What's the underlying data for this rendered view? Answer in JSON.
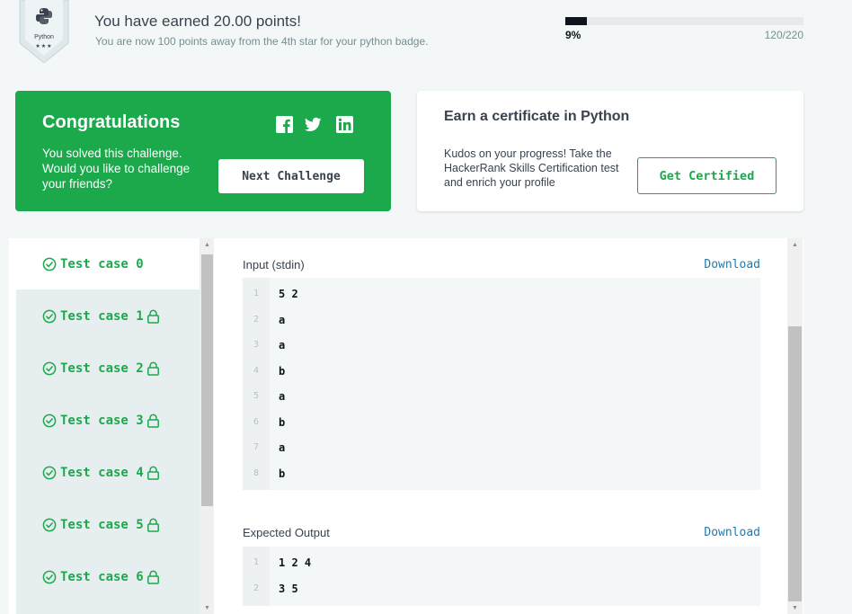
{
  "badge": {
    "label": "Python",
    "stars": "★★★",
    "icon": "python-logo-icon"
  },
  "earned": {
    "title": "You have earned 20.00 points!",
    "subtitle": "You are now 100 points away from the 4th star for your python badge."
  },
  "progress": {
    "percent_label": "9%",
    "count": "120/220",
    "fraction": 0.09
  },
  "congrats": {
    "title": "Congratulations",
    "message": "You solved this challenge. Would you like to challenge your friends?",
    "next_button": "Next Challenge",
    "social_icons": [
      "facebook-icon",
      "twitter-icon",
      "linkedin-icon"
    ]
  },
  "certificate": {
    "title": "Earn a certificate in Python",
    "text": "Kudos on your progress! Take the HackerRank Skills Certification test and enrich your profile",
    "button": "Get Certified"
  },
  "test_cases": [
    {
      "label": "Test case 0",
      "locked": false,
      "active": true
    },
    {
      "label": "Test case 1",
      "locked": true,
      "active": false
    },
    {
      "label": "Test case 2",
      "locked": true,
      "active": false
    },
    {
      "label": "Test case 3",
      "locked": true,
      "active": false
    },
    {
      "label": "Test case 4",
      "locked": true,
      "active": false
    },
    {
      "label": "Test case 5",
      "locked": true,
      "active": false
    },
    {
      "label": "Test case 6",
      "locked": true,
      "active": false
    }
  ],
  "input": {
    "label": "Input (stdin)",
    "download": "Download",
    "lines": [
      {
        "n": "1",
        "text": "5 2"
      },
      {
        "n": "2",
        "text": "a"
      },
      {
        "n": "3",
        "text": "a"
      },
      {
        "n": "4",
        "text": "b"
      },
      {
        "n": "5",
        "text": "a"
      },
      {
        "n": "6",
        "text": "b"
      },
      {
        "n": "7",
        "text": "a"
      },
      {
        "n": "8",
        "text": "b"
      }
    ]
  },
  "output": {
    "label": "Expected Output",
    "download": "Download",
    "lines": [
      {
        "n": "1",
        "text": "1 2 4"
      },
      {
        "n": "2",
        "text": "3 5"
      }
    ]
  },
  "colors": {
    "green": "#1ba94c",
    "dark": "#39424e",
    "link": "#1e7aae"
  }
}
